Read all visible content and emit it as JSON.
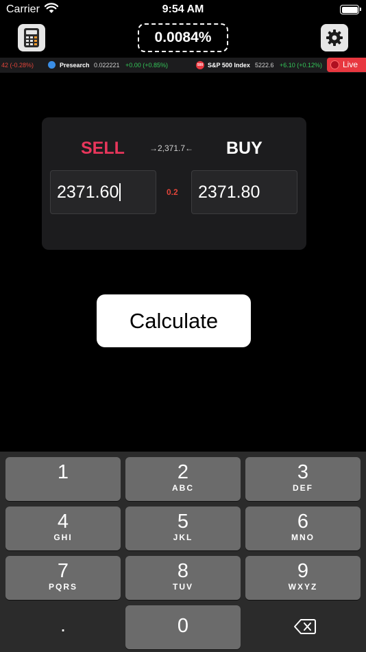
{
  "status_bar": {
    "carrier": "Carrier",
    "time": "9:54 AM"
  },
  "top_bar": {
    "spread_percent": "0.0084%",
    "left_icon": "calculator-icon",
    "right_icon": "gear-icon"
  },
  "ticker": {
    "items": [
      {
        "change": "42 (-0.28%)"
      },
      {
        "name": "Presearch",
        "price": "0.022221",
        "change": "+0.00 (+0.85%)"
      },
      {
        "name": "S&P 500 Index",
        "price": "5222.6",
        "change": "+6.10 (+0.12%)",
        "icon_text": "500"
      }
    ],
    "live_label": "Live"
  },
  "quote": {
    "sell_label": "SELL",
    "buy_label": "BUY",
    "mid_price": "→2,371.7←",
    "sell_price": "2371.60",
    "buy_price": "2371.80",
    "spread": "0.2"
  },
  "calculate_label": "Calculate",
  "keypad": {
    "keys": [
      {
        "digit": "1",
        "letters": ""
      },
      {
        "digit": "2",
        "letters": "ABC"
      },
      {
        "digit": "3",
        "letters": "DEF"
      },
      {
        "digit": "4",
        "letters": "GHI"
      },
      {
        "digit": "5",
        "letters": "JKL"
      },
      {
        "digit": "6",
        "letters": "MNO"
      },
      {
        "digit": "7",
        "letters": "PQRS"
      },
      {
        "digit": "8",
        "letters": "TUV"
      },
      {
        "digit": "9",
        "letters": "WXYZ"
      },
      {
        "digit": "0",
        "letters": ""
      }
    ],
    "decimal_label": ".",
    "delete_icon": "backspace-icon"
  },
  "colors": {
    "sell": "#e8365b",
    "buy": "#ffffff",
    "negative": "#e2453a",
    "positive": "#34c759",
    "live": "#e8373f"
  }
}
